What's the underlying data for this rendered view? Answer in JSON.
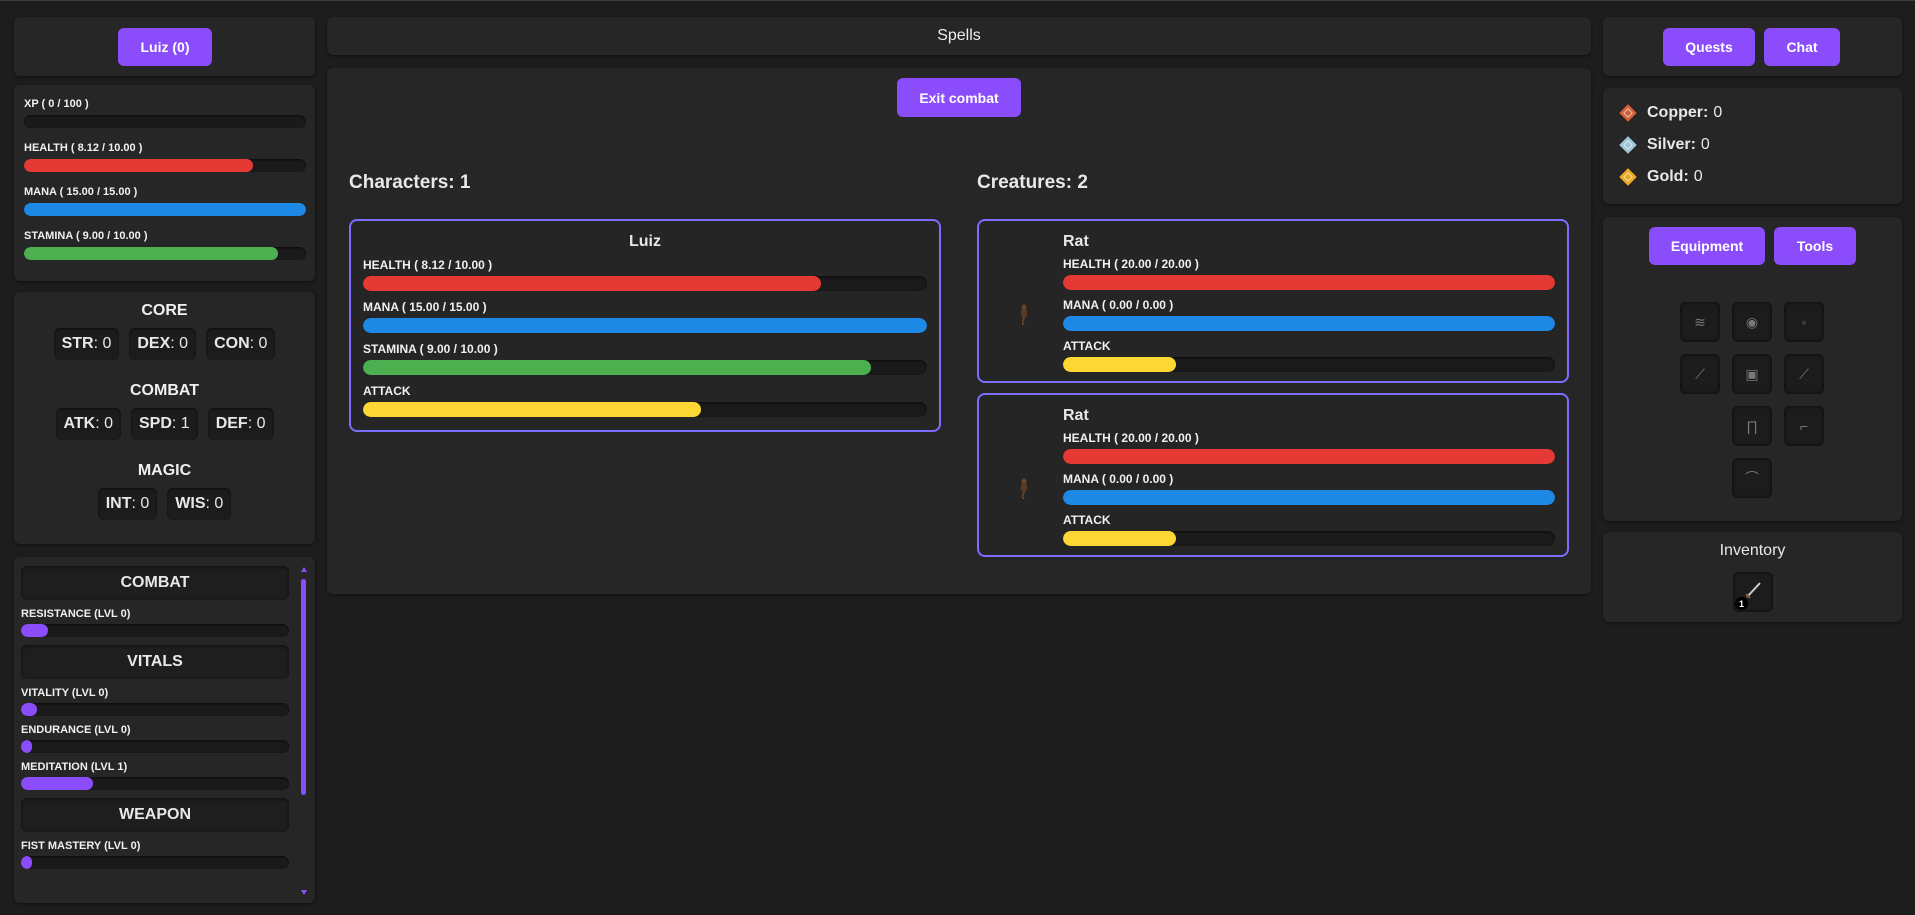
{
  "colors": {
    "accent": "#8b4dfb",
    "health": "#e53935",
    "mana": "#1e88e5",
    "stamina": "#4caf50",
    "attack": "#fdd835",
    "card_border": "#7c6cff"
  },
  "player": {
    "button_label": "Luiz (0)",
    "bars": [
      {
        "label": "XP ( 0 / 100 )",
        "pct": 0,
        "color": "#8b4dfb"
      },
      {
        "label": "HEALTH ( 8.12 / 10.00 )",
        "pct": 0.812,
        "color": "#e53935"
      },
      {
        "label": "MANA ( 15.00 / 15.00 )",
        "pct": 1.0,
        "color": "#1e88e5"
      },
      {
        "label": "STAMINA ( 9.00 / 10.00 )",
        "pct": 0.9,
        "color": "#4caf50"
      }
    ]
  },
  "stats": {
    "core_title": "CORE",
    "core": [
      {
        "name": "STR",
        "value": ": 0"
      },
      {
        "name": "DEX",
        "value": ": 0"
      },
      {
        "name": "CON",
        "value": ": 0"
      }
    ],
    "combat_title": "COMBAT",
    "combat": [
      {
        "name": "ATK",
        "value": ": 0"
      },
      {
        "name": "SPD",
        "value": ": 1"
      },
      {
        "name": "DEF",
        "value": ": 0"
      }
    ],
    "magic_title": "MAGIC",
    "magic": [
      {
        "name": "INT",
        "value": ": 0"
      },
      {
        "name": "WIS",
        "value": ": 0"
      }
    ]
  },
  "skills": {
    "groups": [
      {
        "title": "COMBAT",
        "items": [
          {
            "label": "RESISTANCE (LVL 0)",
            "pct": 0.1
          }
        ]
      },
      {
        "title": "VITALS",
        "items": [
          {
            "label": "VITALITY (LVL 0)",
            "pct": 0.06
          },
          {
            "label": "ENDURANCE (LVL 0)",
            "pct": 0.04
          },
          {
            "label": "MEDITATION (LVL 1)",
            "pct": 0.27
          }
        ]
      },
      {
        "title": "WEAPON",
        "items": [
          {
            "label": "FIST MASTERY (LVL 0)",
            "pct": 0.04
          }
        ]
      }
    ]
  },
  "header": {
    "title": "Spells"
  },
  "combat": {
    "exit_label": "Exit combat",
    "characters_heading": "Characters: 1",
    "creatures_heading": "Creatures: 2",
    "characters": [
      {
        "name": "Luiz",
        "bars": [
          {
            "label": "HEALTH ( 8.12 / 10.00 )",
            "pct": 0.812,
            "color": "#e53935"
          },
          {
            "label": "MANA ( 15.00 / 15.00 )",
            "pct": 1.0,
            "color": "#1e88e5"
          },
          {
            "label": "STAMINA ( 9.00 / 10.00 )",
            "pct": 0.9,
            "color": "#4caf50"
          },
          {
            "label": "ATTACK",
            "pct": 0.6,
            "color": "#fdd835"
          }
        ]
      }
    ],
    "creatures": [
      {
        "name": "Rat",
        "icon": "rat-icon",
        "bars": [
          {
            "label": "HEALTH ( 20.00 / 20.00 )",
            "pct": 1.0,
            "color": "#e53935"
          },
          {
            "label": "MANA ( 0.00 / 0.00 )",
            "pct": 1.0,
            "color": "#1e88e5"
          },
          {
            "label": "ATTACK",
            "pct": 0.23,
            "color": "#fdd835"
          }
        ]
      },
      {
        "name": "Rat",
        "icon": "rat-icon",
        "bars": [
          {
            "label": "HEALTH ( 20.00 / 20.00 )",
            "pct": 1.0,
            "color": "#e53935"
          },
          {
            "label": "MANA ( 0.00 / 0.00 )",
            "pct": 1.0,
            "color": "#1e88e5"
          },
          {
            "label": "ATTACK",
            "pct": 0.23,
            "color": "#fdd835"
          }
        ]
      }
    ]
  },
  "top_right": {
    "quests_label": "Quests",
    "chat_label": "Chat"
  },
  "currency": [
    {
      "name": "Copper:",
      "value": "0",
      "icon": "copper-coin-icon",
      "color": "#d0603a"
    },
    {
      "name": "Silver:",
      "value": "0",
      "icon": "silver-coin-icon",
      "color": "#9fc3d6"
    },
    {
      "name": "Gold:",
      "value": "0",
      "icon": "gold-coin-icon",
      "color": "#e8a820"
    }
  ],
  "equipment": {
    "tab_equipment": "Equipment",
    "tab_tools": "Tools",
    "slots": [
      "hat-slot-icon",
      "helmet-slot-icon",
      "amulet-slot-icon",
      "left-hand-slot-icon",
      "armor-slot-icon",
      "right-hand-slot-icon",
      "legs-slot-icon",
      "gloves-slot-icon",
      "boots-slot-icon"
    ]
  },
  "inventory": {
    "title": "Inventory",
    "items": [
      {
        "icon": "dagger-icon",
        "count": "1"
      }
    ]
  }
}
